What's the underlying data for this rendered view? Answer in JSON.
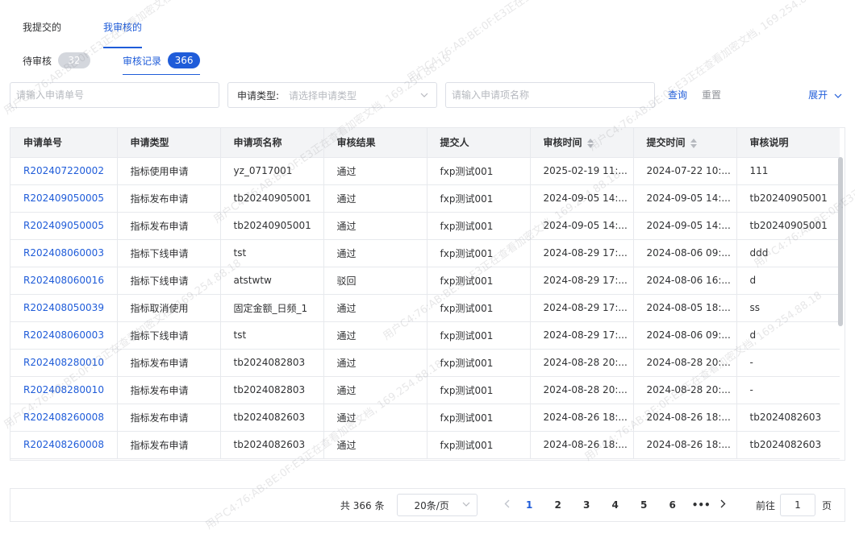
{
  "top_tabs": [
    {
      "label": "我提交的"
    },
    {
      "label": "我审核的"
    }
  ],
  "sub_tabs": {
    "pending": {
      "label": "待审核",
      "count": "32"
    },
    "records": {
      "label": "审核记录",
      "count": "366"
    }
  },
  "filters": {
    "app_no_placeholder": "请输入申请单号",
    "type_label": "申请类型:",
    "type_placeholder": "请选择申请类型",
    "name_placeholder": "请输入申请项名称",
    "query_label": "查询",
    "reset_label": "重置",
    "expand_label": "展开"
  },
  "table": {
    "columns": [
      "申请单号",
      "申请类型",
      "申请项名称",
      "审核结果",
      "提交人",
      "审核时间",
      "提交时间",
      "审核说明"
    ],
    "rows": [
      [
        "R202407220002",
        "指标使用申请",
        "yz_0717001",
        "通过",
        "fxp测试001",
        "2025-02-19 11:...",
        "2024-07-22 10:...",
        "111"
      ],
      [
        "R202409050005",
        "指标发布申请",
        "tb20240905001",
        "通过",
        "fxp测试001",
        "2024-09-05 14:...",
        "2024-09-05 14:...",
        "tb20240905001"
      ],
      [
        "R202409050005",
        "指标发布申请",
        "tb20240905001",
        "通过",
        "fxp测试001",
        "2024-09-05 14:...",
        "2024-09-05 14:...",
        "tb20240905001"
      ],
      [
        "R202408060003",
        "指标下线申请",
        "tst",
        "通过",
        "fxp测试001",
        "2024-08-29 17:...",
        "2024-08-06 09:...",
        "ddd"
      ],
      [
        "R202408060016",
        "指标下线申请",
        "atstwtw",
        "驳回",
        "fxp测试001",
        "2024-08-29 17:...",
        "2024-08-06 16:...",
        "d"
      ],
      [
        "R202408050039",
        "指标取消使用",
        "固定金额_日频_1",
        "通过",
        "fxp测试001",
        "2024-08-29 17:...",
        "2024-08-05 18:...",
        "ss"
      ],
      [
        "R202408060003",
        "指标下线申请",
        "tst",
        "通过",
        "fxp测试001",
        "2024-08-29 17:...",
        "2024-08-06 09:...",
        "d"
      ],
      [
        "R202408280010",
        "指标发布申请",
        "tb2024082803",
        "通过",
        "fxp测试001",
        "2024-08-28 20:...",
        "2024-08-28 20:...",
        "-"
      ],
      [
        "R202408280010",
        "指标发布申请",
        "tb2024082803",
        "通过",
        "fxp测试001",
        "2024-08-28 20:...",
        "2024-08-28 20:...",
        "-"
      ],
      [
        "R202408260008",
        "指标发布申请",
        "tb2024082603",
        "通过",
        "fxp测试001",
        "2024-08-26 18:...",
        "2024-08-26 18:...",
        "tb2024082603"
      ],
      [
        "R202408260008",
        "指标发布申请",
        "tb2024082603",
        "通过",
        "fxp测试001",
        "2024-08-26 18:...",
        "2024-08-26 18:...",
        "tb2024082603"
      ]
    ]
  },
  "pagination": {
    "total_text": "共 366 条",
    "page_size": "20条/页",
    "pages": [
      "1",
      "2",
      "3",
      "4",
      "5",
      "6",
      "•••"
    ],
    "goto_prefix": "前往",
    "goto_value": "1",
    "goto_suffix": "页"
  },
  "watermark": "用户C4:76:AB:BE:0F:E3正在查看加密文档, 169.254.88.18"
}
